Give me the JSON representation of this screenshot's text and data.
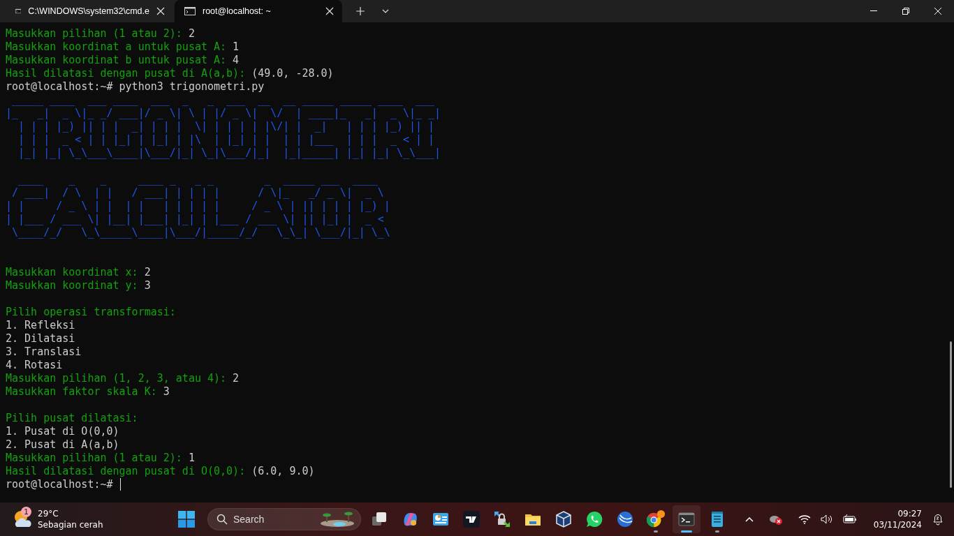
{
  "tabs": [
    {
      "title": "C:\\WINDOWS\\system32\\cmd.e",
      "selected": false
    },
    {
      "title": "root@localhost: ~",
      "selected": true
    }
  ],
  "terminal": {
    "lines": [
      {
        "kind": "input",
        "prompt": "Masukkan pilihan (1 atau 2): ",
        "answer": "2"
      },
      {
        "kind": "input",
        "prompt": "Masukkan koordinat a untuk pusat A: ",
        "answer": "1"
      },
      {
        "kind": "input",
        "prompt": "Masukkan koordinat b untuk pusat A: ",
        "answer": "4"
      },
      {
        "kind": "input",
        "prompt": "Hasil dilatasi dengan pusat di A(a,b): ",
        "answer": "(49.0, -28.0)"
      },
      {
        "kind": "plain",
        "text": "root@localhost:~# python3 trigonometri.py"
      },
      {
        "kind": "art",
        "text": " _____ ____  ___ ____  ___  _   _  ___  __  __ _____ _____ ____  ___"
      },
      {
        "kind": "art",
        "text": "|_   _|  _ \\|_ _/ ___|/ _ \\| \\ | |/ _ \\|  \\/  | ____|_   _|  _ \\|_ _|"
      },
      {
        "kind": "art",
        "text": "  | | | |_) || | |  _| | | |  \\| | | | | |\\/| |  _|   | | | |_) || |"
      },
      {
        "kind": "art",
        "text": "  | | |  _ < | | |_| | |_| | |\\  | |_| | |  | | |___  | | |  _ < | |"
      },
      {
        "kind": "art",
        "text": "  |_| |_| \\_\\___\\____|\\___/|_| \\_|\\___/|_|  |_|_____| |_| |_| \\_\\___|"
      },
      {
        "kind": "blank"
      },
      {
        "kind": "art",
        "text": "  ____    _    _     ____ _   _ _        _  _____ ___  ____"
      },
      {
        "kind": "art",
        "text": " / ___|  / \\  | |   / ___| | | | |      / \\|_   _/ _ \\|  _ \\"
      },
      {
        "kind": "art",
        "text": "| |     / _ \\ | |  | |   | | | | |     / _ \\ | || | | | |_) |"
      },
      {
        "kind": "art",
        "text": "| |___ / ___ \\| |__| |___| |_| | |___ / ___ \\| || |_| |  _ <"
      },
      {
        "kind": "art",
        "text": " \\____/_/   \\_\\_____\\____|\\___/|_____/_/   \\_\\_| \\___/|_| \\_\\"
      },
      {
        "kind": "blank"
      },
      {
        "kind": "blank"
      },
      {
        "kind": "input",
        "prompt": "Masukkan koordinat x: ",
        "answer": "2"
      },
      {
        "kind": "input",
        "prompt": "Masukkan koordinat y: ",
        "answer": "3"
      },
      {
        "kind": "blank"
      },
      {
        "kind": "green",
        "text": "Pilih operasi transformasi:"
      },
      {
        "kind": "plain",
        "text": "1. Refleksi"
      },
      {
        "kind": "plain",
        "text": "2. Dilatasi"
      },
      {
        "kind": "plain",
        "text": "3. Translasi"
      },
      {
        "kind": "plain",
        "text": "4. Rotasi"
      },
      {
        "kind": "input",
        "prompt": "Masukkan pilihan (1, 2, 3, atau 4): ",
        "answer": "2"
      },
      {
        "kind": "input",
        "prompt": "Masukkan faktor skala K: ",
        "answer": "3"
      },
      {
        "kind": "blank"
      },
      {
        "kind": "green",
        "text": "Pilih pusat dilatasi:"
      },
      {
        "kind": "plain",
        "text": "1. Pusat di O(0,0)"
      },
      {
        "kind": "plain",
        "text": "2. Pusat di A(a,b)"
      },
      {
        "kind": "input",
        "prompt": "Masukkan pilihan (1 atau 2): ",
        "answer": "1"
      },
      {
        "kind": "input",
        "prompt": "Hasil dilatasi dengan pusat di O(0,0): ",
        "answer": "(6.0, 9.0)"
      },
      {
        "kind": "cursor",
        "text": "root@localhost:~# "
      }
    ]
  },
  "taskbar": {
    "weather": {
      "badge": "1",
      "temperature": "29°C",
      "condition": "Sebagian cerah"
    },
    "search": {
      "placeholder": "Search"
    },
    "apps": [
      {
        "kind": "stack",
        "active": false,
        "running": false
      },
      {
        "kind": "swirl",
        "active": false,
        "running": false
      },
      {
        "kind": "chartwin",
        "active": false,
        "running": false
      },
      {
        "kind": "tile",
        "active": false,
        "running": false
      },
      {
        "kind": "lock",
        "active": false,
        "running": false
      },
      {
        "kind": "folder",
        "active": false,
        "running": false
      },
      {
        "kind": "cube",
        "active": false,
        "running": false
      },
      {
        "kind": "chat",
        "active": false,
        "running": false
      },
      {
        "kind": "globe",
        "active": false,
        "running": false
      },
      {
        "kind": "browser",
        "active": false,
        "running": true
      },
      {
        "kind": "terminal",
        "active": true,
        "running": true
      },
      {
        "kind": "notepad",
        "active": false,
        "running": true
      }
    ],
    "time": "09:27",
    "date": "03/11/2024"
  }
}
